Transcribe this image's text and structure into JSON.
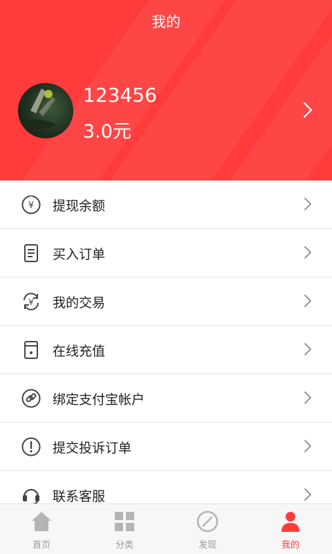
{
  "header": {
    "title": "我的",
    "username": "123456",
    "balance": "3.0元",
    "brand_color": "#ff3b3b"
  },
  "menu": [
    {
      "label": "提现余额",
      "icon": "yuan-circle-icon"
    },
    {
      "label": "买入订单",
      "icon": "document-icon"
    },
    {
      "label": "我的交易",
      "icon": "yuan-exchange-icon"
    },
    {
      "label": "在线充值",
      "icon": "card-icon"
    },
    {
      "label": "绑定支付宝帐户",
      "icon": "link-icon"
    },
    {
      "label": "提交投诉订单",
      "icon": "exclamation-icon"
    },
    {
      "label": "联系客服",
      "icon": "headset-icon"
    }
  ],
  "tabs": [
    {
      "label": "首页",
      "icon": "home-icon"
    },
    {
      "label": "分类",
      "icon": "grid-icon"
    },
    {
      "label": "发现",
      "icon": "compass-icon"
    },
    {
      "label": "我的",
      "icon": "user-icon",
      "active": true
    }
  ]
}
